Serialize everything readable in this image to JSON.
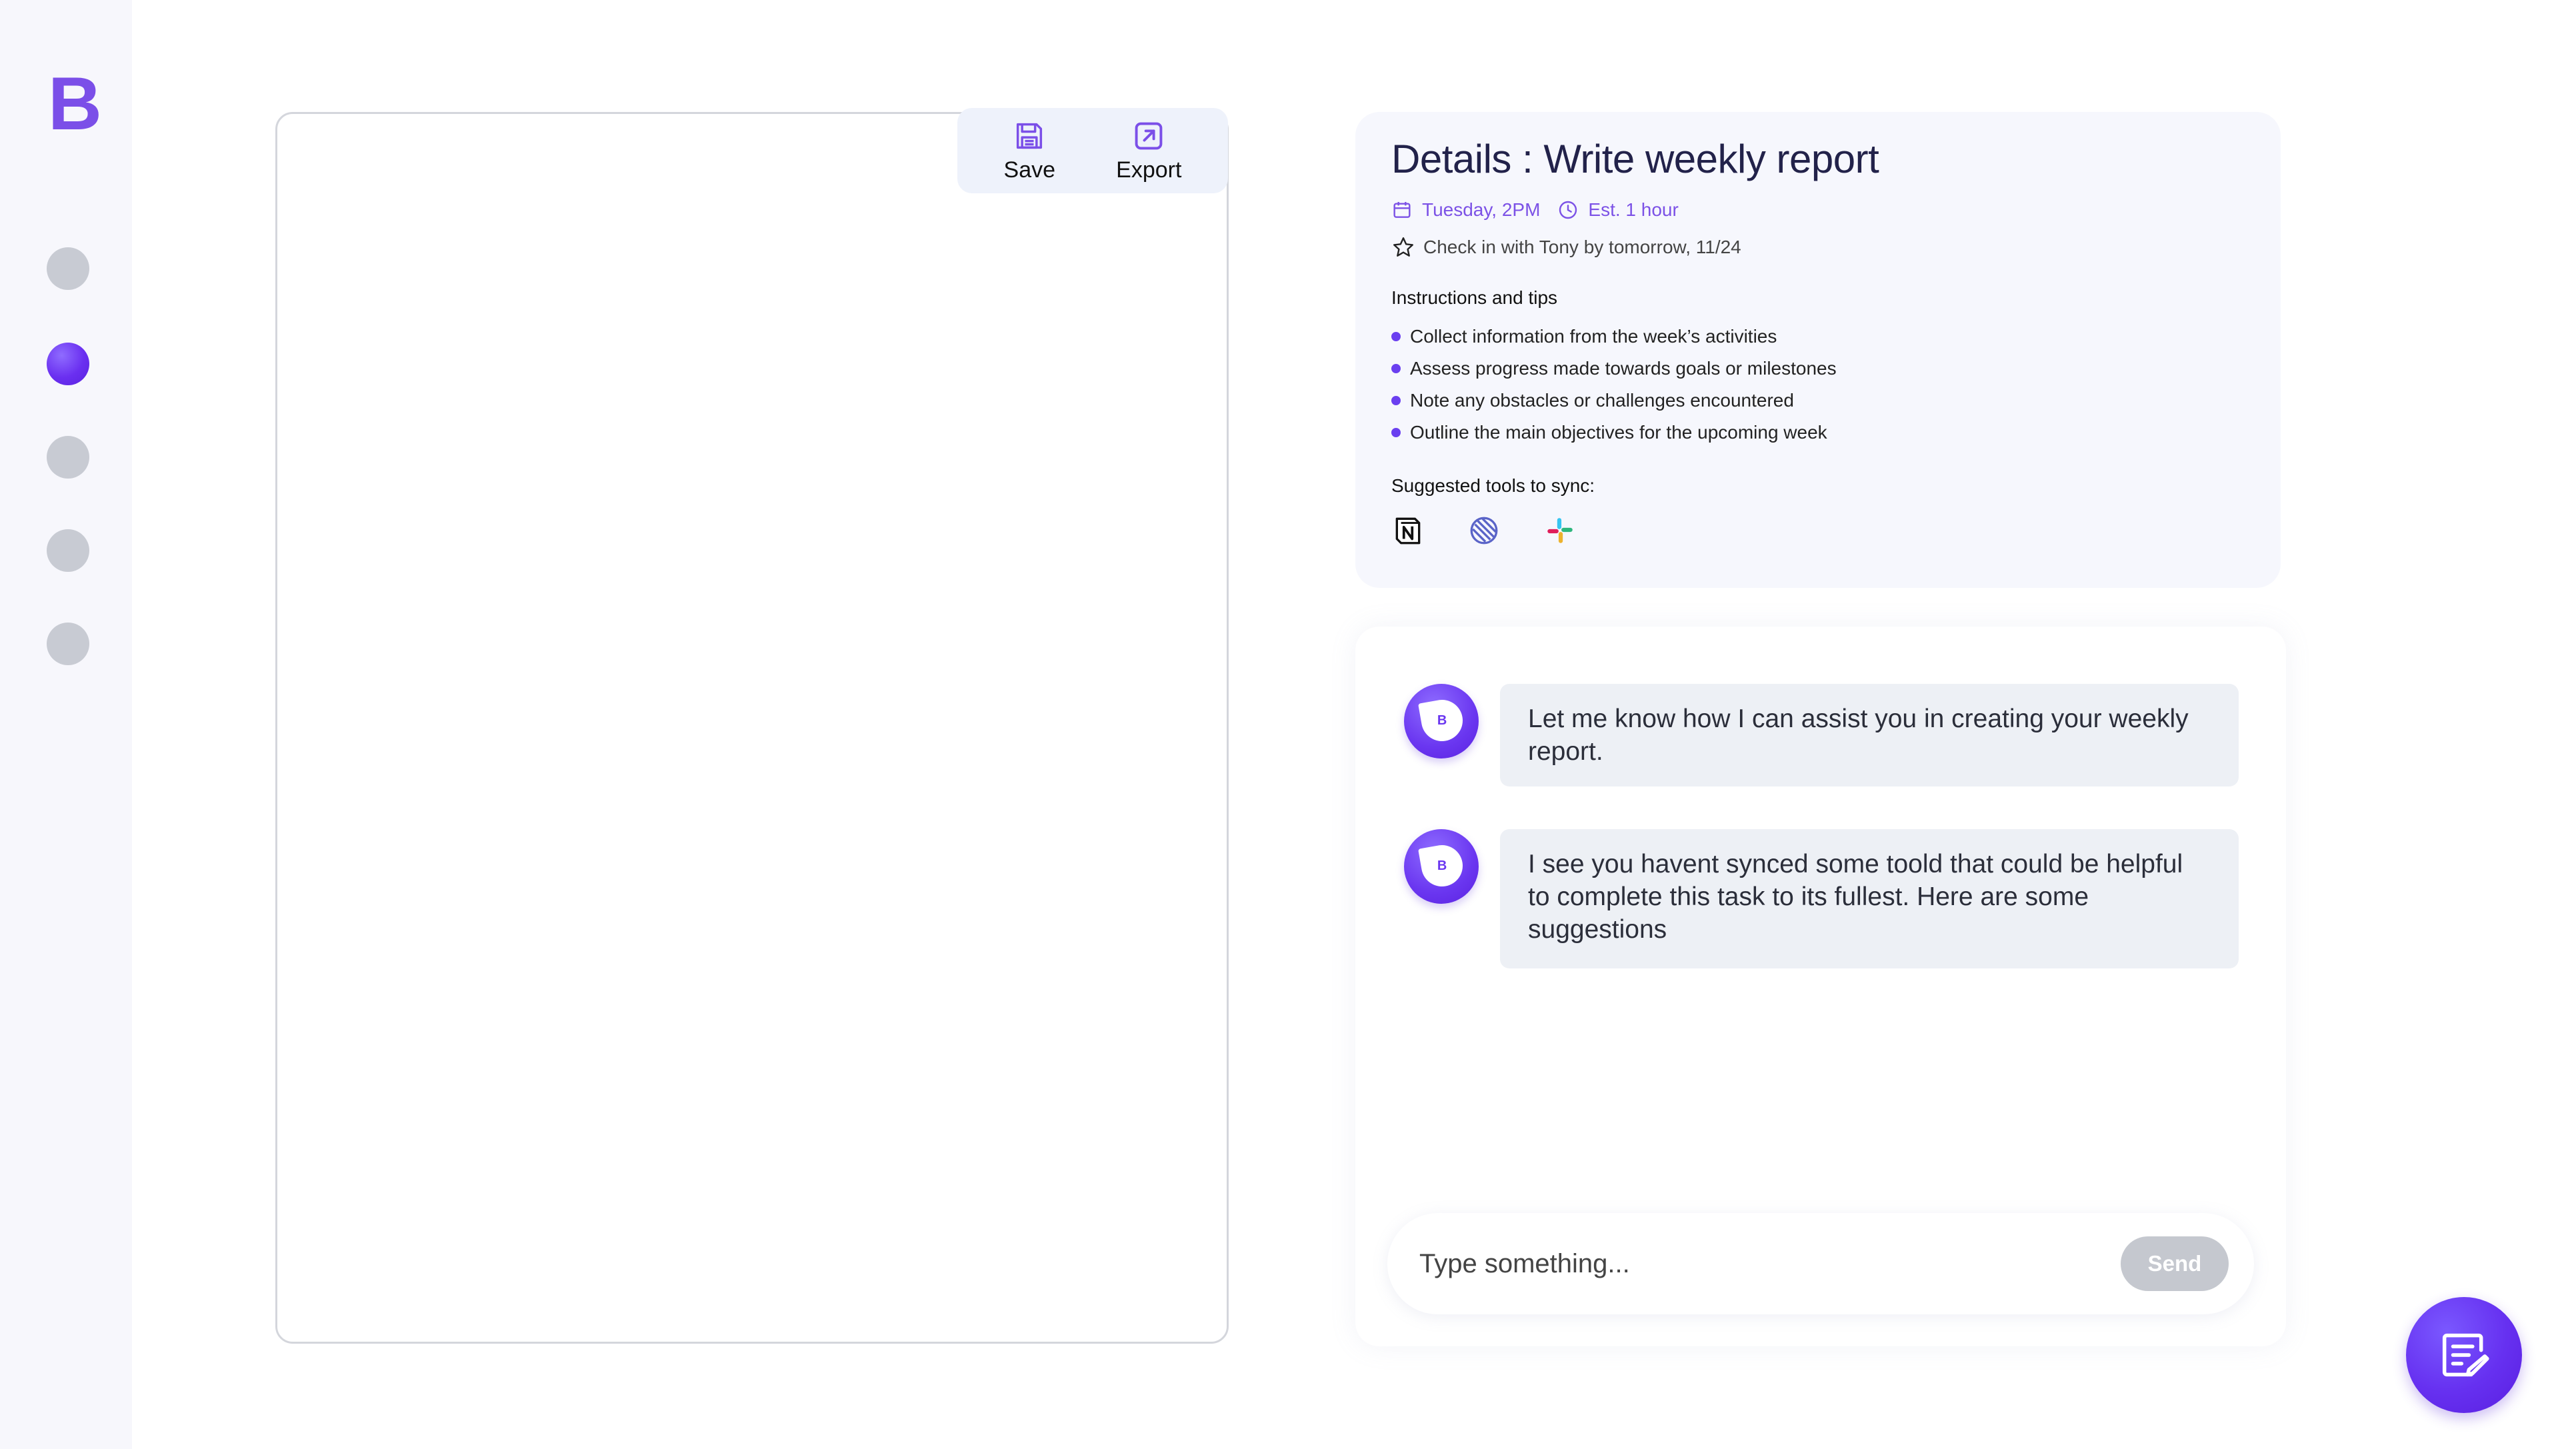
{
  "sidebar": {
    "logo": "B",
    "nav_items": [
      "nav-1",
      "nav-2",
      "nav-3",
      "nav-4",
      "nav-5"
    ],
    "active_index": 1
  },
  "editor": {
    "toolbar": {
      "save_label": "Save",
      "export_label": "Export"
    }
  },
  "details": {
    "title": "Details : Write weekly report",
    "date": "Tuesday, 2PM",
    "estimate": "Est. 1 hour",
    "checkin": "Check in with Tony by tomorrow, 11/24",
    "instructions_title": "Instructions and tips",
    "tips": [
      "Collect information from the week’s activities",
      "Assess progress made towards goals or milestones",
      "Note any obstacles or challenges encountered",
      "Outline the main objectives for the upcoming week"
    ],
    "tools_title": "Suggested tools to sync:",
    "tools": [
      "notion-icon",
      "linear-icon",
      "slack-icon"
    ]
  },
  "chat": {
    "avatar_letter": "B",
    "messages": [
      "Let me know how I can assist you in creating your weekly report.",
      "I see you havent synced some toold that could be helpful to complete this task to its fullest. Here are some suggestions"
    ],
    "input_placeholder": "Type something...",
    "send_label": "Send"
  },
  "colors": {
    "accent": "#6a36f0",
    "accent_text": "#7c52e6",
    "bubble_bg": "#edf0f5",
    "send_disabled": "#c5c8cf"
  }
}
